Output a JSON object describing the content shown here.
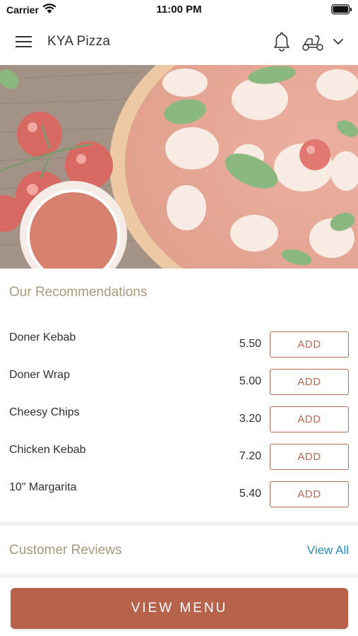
{
  "status_bar": {
    "carrier": "Carrier",
    "time": "11:00 PM",
    "icons": [
      "wifi-icon",
      "battery-icon"
    ]
  },
  "header": {
    "title": "KYA Pizza",
    "icons": [
      "menu-icon",
      "bell-icon",
      "scooter-icon",
      "chevron-down-icon"
    ]
  },
  "hero": {
    "image": "pizza-with-tomatoes-and-sauce"
  },
  "recommendations": {
    "title": "Our Recommendations",
    "items": [
      {
        "name": "Doner Kebab",
        "price": "5.50",
        "action": "ADD"
      },
      {
        "name": "Doner Wrap",
        "price": "5.00",
        "action": "ADD"
      },
      {
        "name": "Cheesy Chips",
        "price": "3.20",
        "action": "ADD"
      },
      {
        "name": "Chicken Kebab",
        "price": "7.20",
        "action": "ADD"
      },
      {
        "name": "10\" Margarita",
        "price": "5.40",
        "action": "ADD"
      }
    ]
  },
  "reviews": {
    "title": "Customer Reviews",
    "view_all": "View All"
  },
  "footer": {
    "view_menu": "VIEW MENU"
  },
  "colors": {
    "accent": "#b7624b",
    "section_title": "#a9997b",
    "link": "#2a8bb8"
  }
}
